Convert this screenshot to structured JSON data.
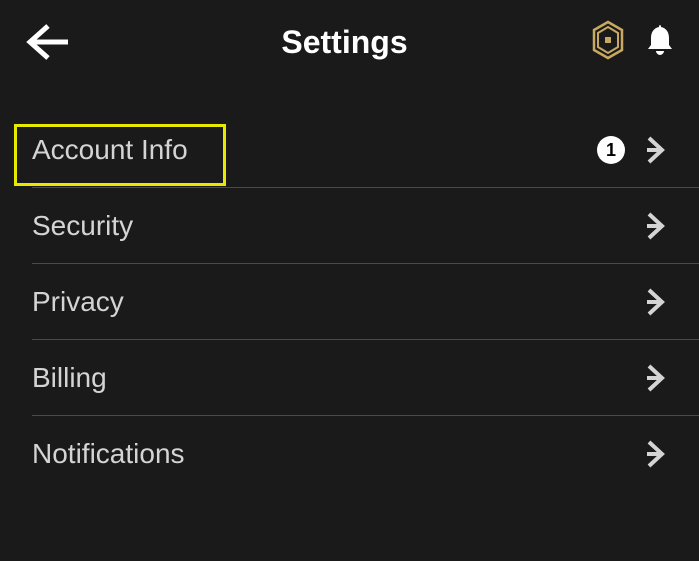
{
  "header": {
    "title": "Settings"
  },
  "items": [
    {
      "label": "Account Info",
      "badge": "1"
    },
    {
      "label": "Security"
    },
    {
      "label": "Privacy"
    },
    {
      "label": "Billing"
    },
    {
      "label": "Notifications"
    }
  ]
}
